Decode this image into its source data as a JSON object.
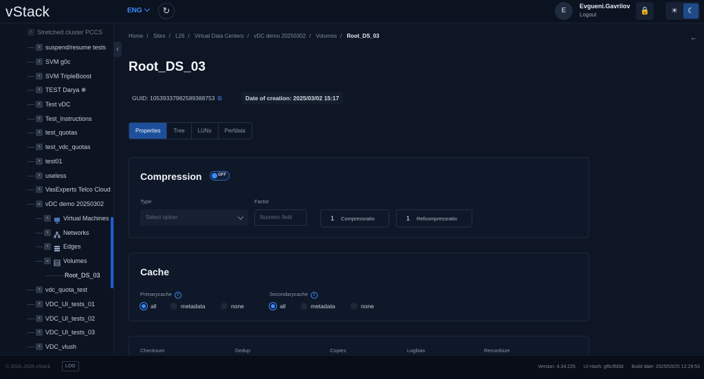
{
  "app": {
    "logo": "vStack",
    "language": "ENG",
    "refresh_icon": "refresh-icon"
  },
  "user": {
    "initial": "E",
    "name": "Evgueni.Gavrilov",
    "logout": "Logout"
  },
  "sidebar": {
    "items": [
      {
        "label": "Stretched cluster PCCS",
        "expanded": false
      },
      {
        "label": "suspend/resume tests",
        "expanded": false
      },
      {
        "label": "SVM g0c",
        "expanded": false
      },
      {
        "label": "SVM TripleBoost",
        "expanded": false
      },
      {
        "label": "TEST Darya ❄",
        "expanded": false
      },
      {
        "label": "Test vDC",
        "expanded": false
      },
      {
        "label": "Test_Instructions",
        "expanded": false
      },
      {
        "label": "test_quotas",
        "expanded": false
      },
      {
        "label": "test_vdc_quotas",
        "expanded": false
      },
      {
        "label": "test01",
        "expanded": false
      },
      {
        "label": "useless",
        "expanded": false
      },
      {
        "label": "VasExperts Telco Cloud",
        "expanded": false
      },
      {
        "label": "vDC demo 20250302",
        "expanded": true
      },
      {
        "label": "Virtual Machines",
        "expanded": false
      },
      {
        "label": "Networks",
        "expanded": false
      },
      {
        "label": "Edges",
        "expanded": false
      },
      {
        "label": "Volumes",
        "expanded": true
      },
      {
        "label": "Root_DS_03",
        "selected": true
      },
      {
        "label": "vdc_quota_test",
        "expanded": false
      },
      {
        "label": "VDC_UI_tests_01",
        "expanded": false
      },
      {
        "label": "VDC_UI_tests_02",
        "expanded": false
      },
      {
        "label": "VDC_UI_tests_03",
        "expanded": false
      },
      {
        "label": "VDC_vlush",
        "expanded": false
      }
    ]
  },
  "breadcrumb": [
    "Home",
    "Sites",
    "L26",
    "Virtual Data Centers",
    "vDC demo 20250302",
    "Volumes",
    "Root_DS_03"
  ],
  "page": {
    "title": "Root_DS_03",
    "guid": "GUID: 10539337982589388753",
    "date_of_creation": "Date of creation: 2025/03/02 15:17"
  },
  "tabs": [
    "Properties",
    "Tree",
    "LUNs",
    "Perfdata"
  ],
  "compression": {
    "title": "Compression",
    "toggle": "OFF",
    "type_label": "Type",
    "type_placeholder": "Select option",
    "factor_label": "Factor",
    "factor_placeholder": "Numeric field",
    "compressratio_value": "1",
    "compressratio_label": "Compressratio",
    "refcompressratio_value": "1",
    "refcompressratio_label": "Refcompressratio"
  },
  "cache": {
    "title": "Cache",
    "primary_label": "Primarycache",
    "secondary_label": "Secondarycache",
    "options": [
      "all",
      "metadata",
      "none"
    ],
    "primary_selected": "all",
    "secondary_selected": "all"
  },
  "bottom_panel": {
    "columns": [
      "Checksum",
      "Dedup",
      "Copies",
      "Logbias",
      "Recordsize"
    ]
  },
  "footer": {
    "copyright": "© 2016–2025 vStack",
    "log_button": "LOG",
    "version": "Version: 4.34.225",
    "ui_hash": "UI Hash: gf6cffd3d",
    "build_date": "Build date: 2025/03/25 12:29:53"
  },
  "colors": {
    "accent": "#3d8bff",
    "active_tab": "#1d4f9c",
    "background": "#0e1625"
  }
}
